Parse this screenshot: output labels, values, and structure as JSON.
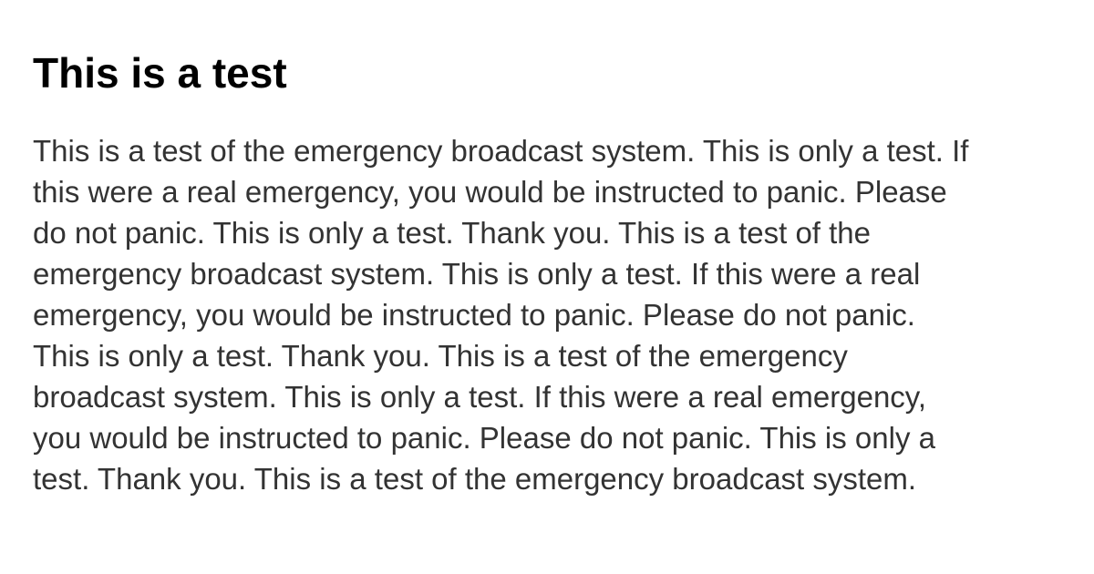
{
  "heading": "This is a test",
  "paragraph_lines": [
    "This is a test of the emergency broadcast system. This is only a test. If",
    "this were a real emergency, you would be instructed to panic. Please",
    "do not panic. This is only a test. Thank you. This is a test of the",
    "emergency broadcast system. This is only a test. If this were a real",
    "emergency, you would be instructed to panic. Please do not panic.",
    "This is only a test. Thank you. This is a test of the emergency",
    "broadcast system. This is only a test. If this were a real emergency,",
    "you would be instructed to panic. Please do not panic. This is only a",
    "test. Thank you. This is a test of the emergency broadcast system."
  ],
  "colors": {
    "heading": "#000000",
    "body": "#333333",
    "background": "#ffffff"
  }
}
